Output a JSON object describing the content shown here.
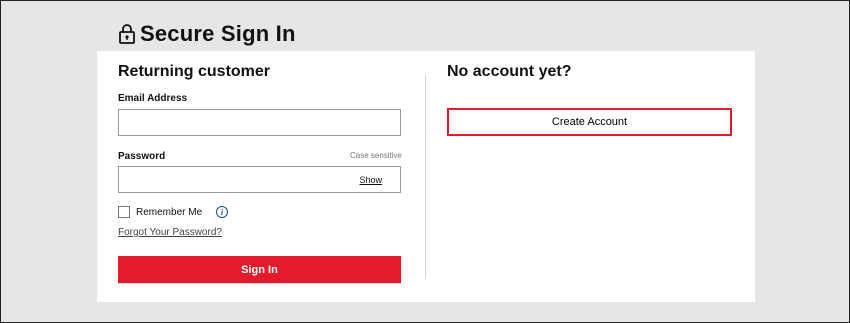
{
  "header": {
    "title": "Secure Sign In",
    "icon": "lock-icon"
  },
  "returning": {
    "title": "Returning customer",
    "email_label": "Email Address",
    "email_value": "",
    "password_label": "Password",
    "case_note": "Case sensitive",
    "password_value": "",
    "show_label": "Show",
    "remember_label": "Remember Me",
    "remember_checked": false,
    "info_icon": "info-icon",
    "forgot_label": "Forgot Your Password?",
    "signin_label": "Sign In"
  },
  "new_customer": {
    "title": "No account yet?",
    "create_label": "Create Account"
  },
  "colors": {
    "accent": "#e31b2d",
    "background": "#e6e6e6",
    "info": "#1b4f9c"
  }
}
